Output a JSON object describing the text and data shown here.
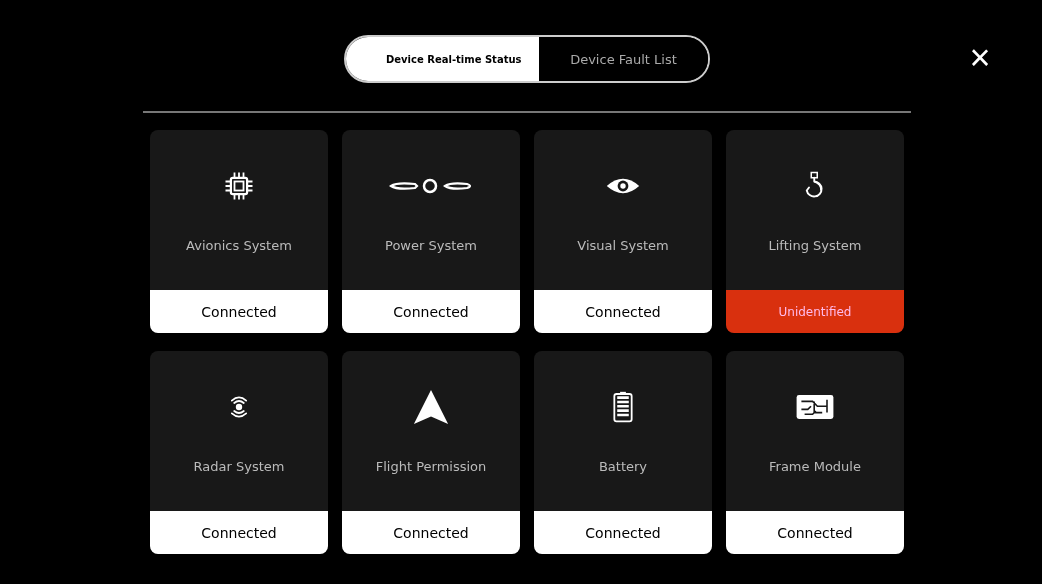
{
  "tabs": [
    {
      "label": "Device Real-time Status",
      "selected": true
    },
    {
      "label": "Device Fault List",
      "selected": false
    }
  ],
  "close": "×",
  "cards": [
    {
      "kind": "chip",
      "name": "Avionics System",
      "status": "Connected",
      "fault": false
    },
    {
      "kind": "propeller",
      "name": "Power System",
      "status": "Connected",
      "fault": false
    },
    {
      "kind": "eye",
      "name": "Visual System",
      "status": "Connected",
      "fault": false
    },
    {
      "kind": "hook",
      "name": "Lifting System",
      "status": "Unidentified",
      "fault": true
    },
    {
      "kind": "radar",
      "name": "Radar System",
      "status": "Connected",
      "fault": false
    },
    {
      "kind": "arrow",
      "name": "Flight Permission",
      "status": "Connected",
      "fault": false
    },
    {
      "kind": "battery",
      "name": "Battery",
      "status": "Connected",
      "fault": false
    },
    {
      "kind": "circuit",
      "name": "Frame Module",
      "status": "Connected",
      "fault": false
    }
  ]
}
